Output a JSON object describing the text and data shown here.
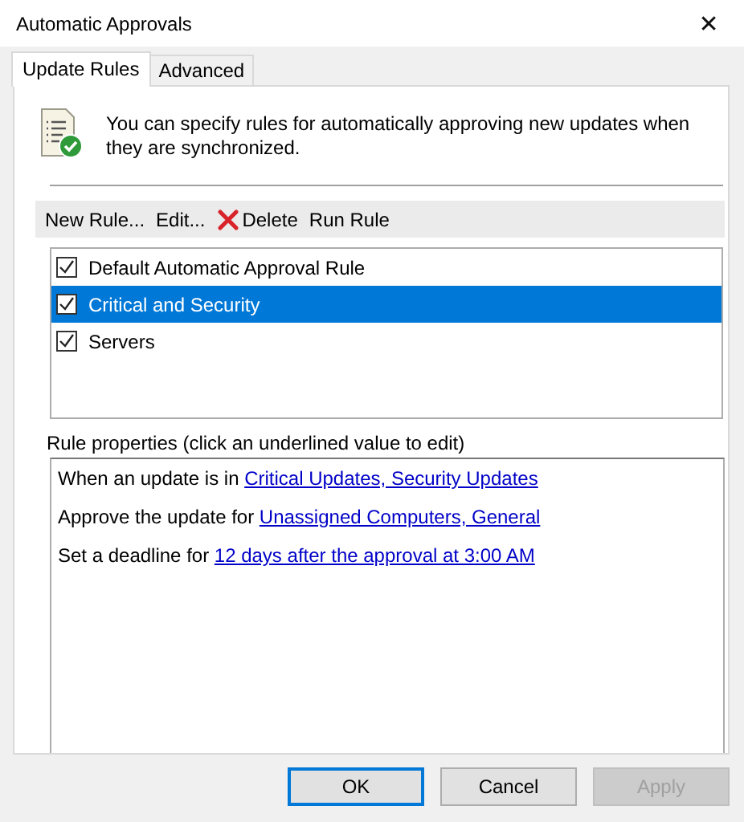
{
  "window": {
    "title": "Automatic Approvals",
    "close": "✕"
  },
  "tabs": [
    {
      "label": "Update Rules",
      "selected": true
    },
    {
      "label": "Advanced",
      "selected": false
    }
  ],
  "intro": "You can specify rules for automatically approving new updates when they are synchronized.",
  "toolbar": [
    {
      "label": "New Rule...",
      "kind": "text"
    },
    {
      "label": "Edit...",
      "kind": "text"
    },
    {
      "label": "Delete",
      "kind": "delete"
    },
    {
      "label": "Run Rule",
      "kind": "text"
    }
  ],
  "rules": [
    {
      "label": "Default Automatic Approval Rule",
      "checked": true,
      "selected": false
    },
    {
      "label": "Critical and Security",
      "checked": true,
      "selected": true
    },
    {
      "label": "Servers",
      "checked": true,
      "selected": false
    }
  ],
  "properties_label": "Rule properties (click an underlined value to edit)",
  "properties": [
    {
      "text": "When an update is in",
      "link": "Critical Updates, Security Updates"
    },
    {
      "text": "Approve the update for",
      "link": "Unassigned Computers, General"
    },
    {
      "text": "Set a deadline for",
      "link": "12 days after the approval at 3:00 AM"
    }
  ],
  "buttons": [
    {
      "label": "OK",
      "default": true,
      "disabled": false
    },
    {
      "label": "Cancel",
      "default": false,
      "disabled": false
    },
    {
      "label": "Apply",
      "default": false,
      "disabled": true
    }
  ]
}
